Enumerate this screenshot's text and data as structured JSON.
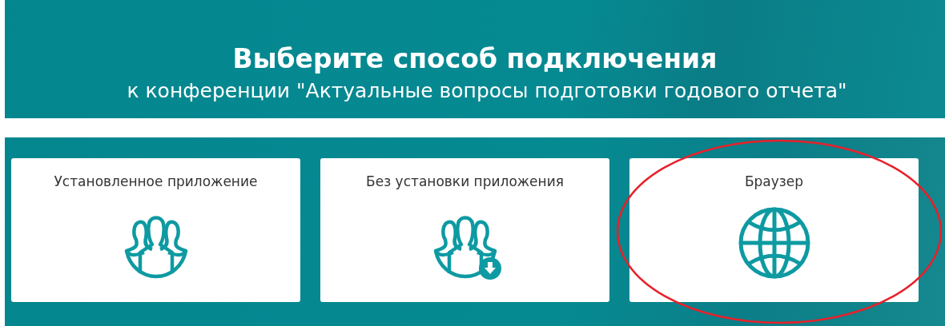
{
  "header": {
    "title": "Выберите способ подключения",
    "subtitle": "к конференции \"Актуальные вопросы подготовки годового отчета\""
  },
  "options": [
    {
      "label": "Установленное приложение",
      "kind": "people",
      "highlighted": false
    },
    {
      "label": "Без установки приложения",
      "kind": "people-download",
      "highlighted": false
    },
    {
      "label": "Браузер",
      "kind": "globe",
      "highlighted": true
    }
  ]
}
